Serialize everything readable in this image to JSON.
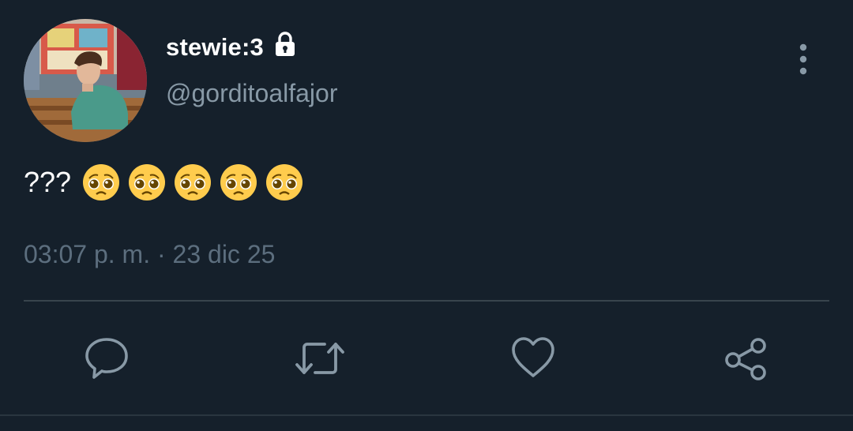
{
  "tweet": {
    "display_name": "stewie:3",
    "handle": "@gorditoalfajor",
    "text": "???",
    "emojis": [
      "pleading-face",
      "pleading-face",
      "pleading-face",
      "pleading-face",
      "pleading-face"
    ],
    "timestamp": "03:07 p. m. · 23 dic 25",
    "protected": true
  },
  "icons": {
    "lock": "lock-icon",
    "more": "vertical-ellipsis-icon",
    "reply": "speech-bubble-icon",
    "retweet": "retweet-icon",
    "like": "heart-icon",
    "share": "share-icon"
  },
  "colors": {
    "background": "#15202b",
    "primary_text": "#ffffff",
    "secondary_text": "#8899a6",
    "icon": "#8899a6",
    "divider": "#38444d"
  }
}
